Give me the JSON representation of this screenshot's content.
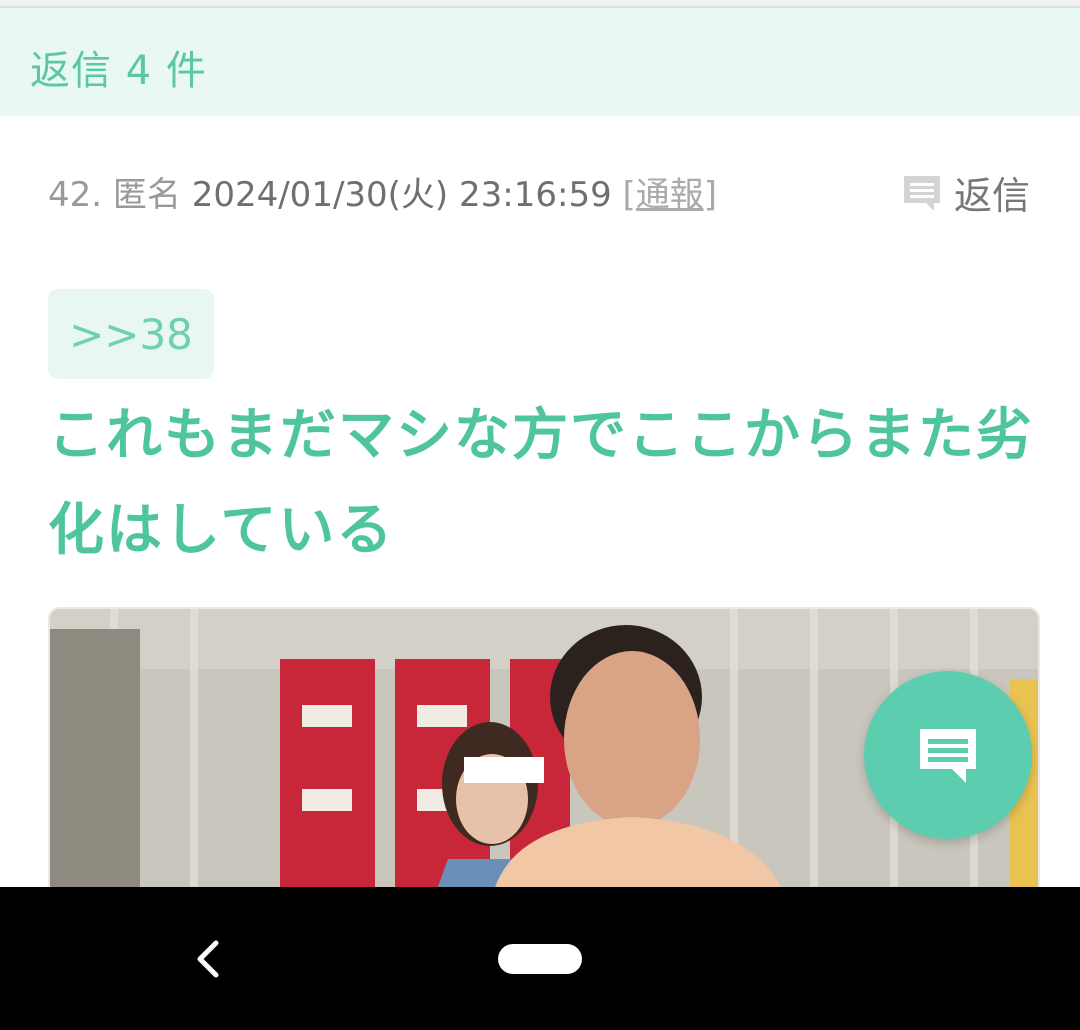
{
  "header": {
    "reply_count": "返信 4 件"
  },
  "post": {
    "number": "42.",
    "author": "匿名",
    "date": "2024/01/30(火) 23:16:59",
    "report_label": "[通報]",
    "reply_label": "返信",
    "quote": ">>38",
    "body": "これもまだマシな方でここからまた劣化はしている"
  },
  "icons": {
    "reply": "comment-icon",
    "fab": "comment-icon",
    "back": "chevron-left-icon"
  },
  "colors": {
    "accent": "#4fc59f",
    "header_bg": "#e9f8f3",
    "fab": "#5ccdaf"
  }
}
